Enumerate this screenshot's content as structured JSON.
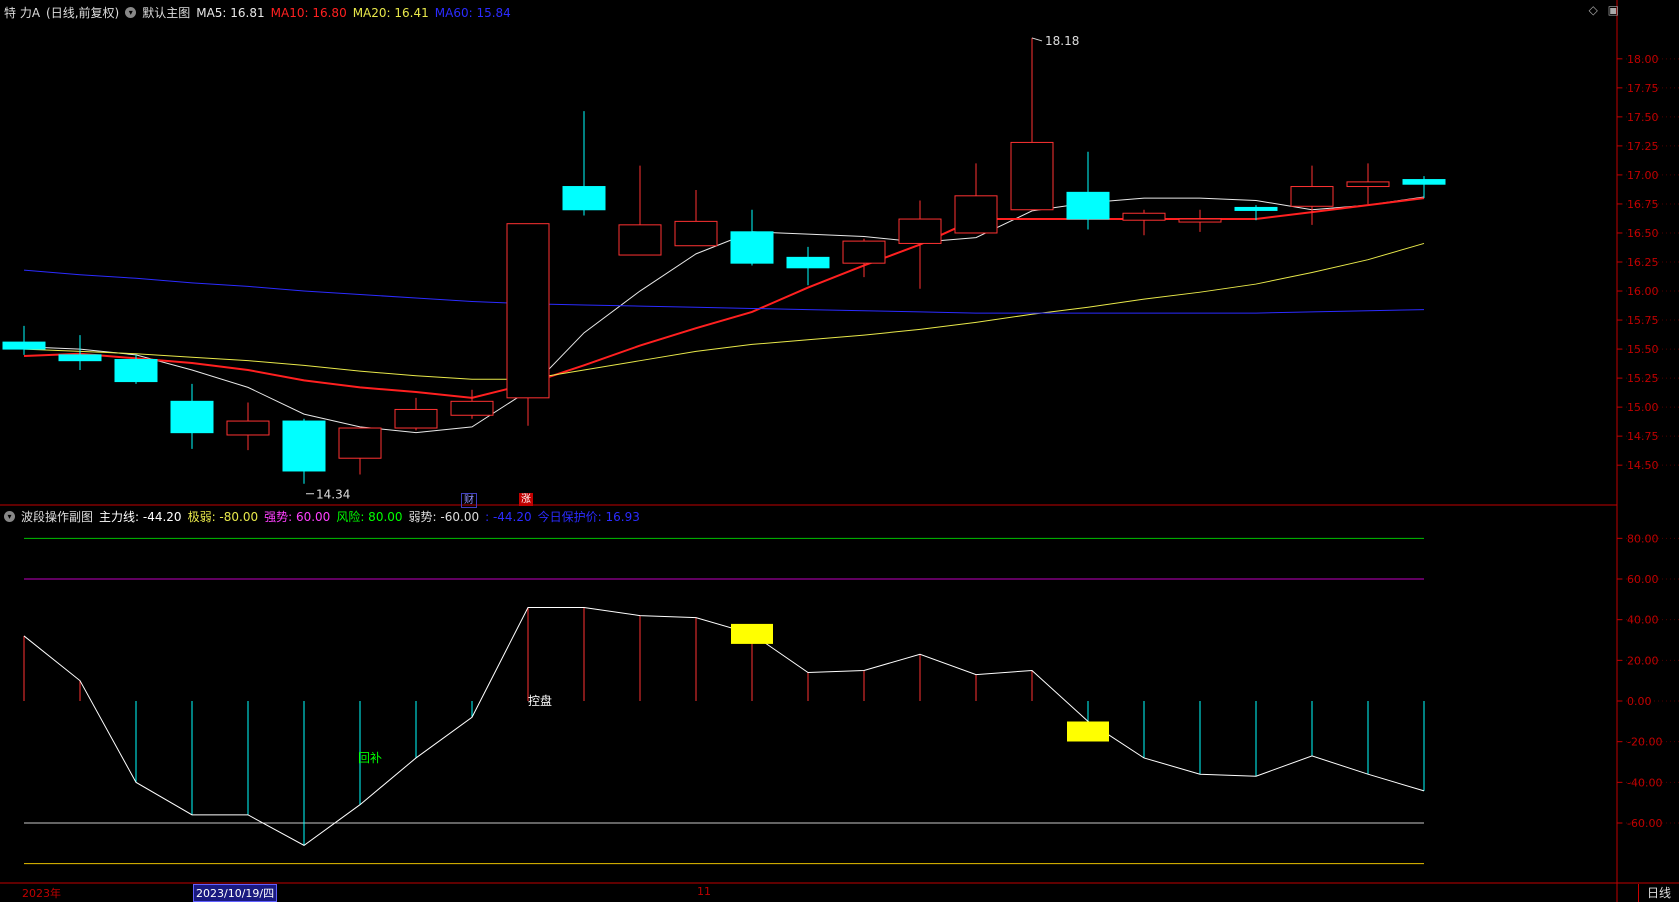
{
  "main_header": {
    "stock_name": "特 力A",
    "period_label": "(日线,前复权)",
    "template_label": "默认主图",
    "ma5": "MA5: 16.81",
    "ma10": "MA10: 16.80",
    "ma20": "MA20: 16.41",
    "ma60": "MA60: 15.84"
  },
  "sub_header": {
    "indicator_name": "波段操作副图",
    "main_line": "主力线: -44.20",
    "weak_extreme": "极弱: -80.00",
    "strong": "强势: 60.00",
    "risk": "风险: 80.00",
    "weak": "弱势: -60.00",
    "extra": ": -44.20",
    "cost_price": "今日保护价: 16.93"
  },
  "colors": {
    "up": "#ff3232",
    "down": "#00ffff",
    "ma5": "#e8e8e8",
    "ma10": "#ff2020",
    "ma20": "#e8e84a",
    "ma60": "#2b2bff",
    "axis": "#c00000"
  },
  "annotations": {
    "high_label": "18.18",
    "low_label": "14.34",
    "marker_cai": "财",
    "marker_zhang": "涨",
    "label_kongpan": "控盘",
    "label_huibu": "回补"
  },
  "bottom_bar": {
    "year_label": "2023年",
    "date_label": "2023/10/19/四",
    "month_label": "11",
    "period_button": "日线"
  },
  "chart_data": [
    {
      "type": "candlestick",
      "ylim": [
        14.2,
        18.3
      ],
      "y_ticks": [
        "18.00",
        "17.75",
        "17.50",
        "17.25",
        "17.00",
        "16.75",
        "16.50",
        "16.25",
        "16.00",
        "15.75",
        "15.50",
        "15.25",
        "15.00",
        "14.75",
        "14.50"
      ],
      "candles": [
        {
          "o": 15.56,
          "c": 15.5,
          "h": 15.7,
          "l": 15.45
        },
        {
          "o": 15.45,
          "c": 15.4,
          "h": 15.62,
          "l": 15.32
        },
        {
          "o": 15.41,
          "c": 15.22,
          "h": 15.45,
          "l": 15.2
        },
        {
          "o": 15.05,
          "c": 14.78,
          "h": 15.2,
          "l": 14.64
        },
        {
          "o": 14.76,
          "c": 14.88,
          "h": 15.04,
          "l": 14.63
        },
        {
          "o": 14.88,
          "c": 14.45,
          "h": 14.9,
          "l": 14.34
        },
        {
          "o": 14.56,
          "c": 14.82,
          "h": 14.82,
          "l": 14.42
        },
        {
          "o": 14.82,
          "c": 14.98,
          "h": 15.08,
          "l": 14.8
        },
        {
          "o": 14.93,
          "c": 15.05,
          "h": 15.15,
          "l": 14.9
        },
        {
          "o": 15.08,
          "c": 16.58,
          "h": 16.58,
          "l": 14.84
        },
        {
          "o": 16.9,
          "c": 16.7,
          "h": 17.55,
          "l": 16.65
        },
        {
          "o": 16.31,
          "c": 16.57,
          "h": 17.08,
          "l": 16.31
        },
        {
          "o": 16.39,
          "c": 16.6,
          "h": 16.87,
          "l": 16.39
        },
        {
          "o": 16.51,
          "c": 16.24,
          "h": 16.7,
          "l": 16.22
        },
        {
          "o": 16.29,
          "c": 16.2,
          "h": 16.38,
          "l": 16.05
        },
        {
          "o": 16.24,
          "c": 16.43,
          "h": 16.45,
          "l": 16.12
        },
        {
          "o": 16.41,
          "c": 16.62,
          "h": 16.78,
          "l": 16.02
        },
        {
          "o": 16.5,
          "c": 16.82,
          "h": 17.1,
          "l": 16.5
        },
        {
          "o": 16.7,
          "c": 17.28,
          "h": 18.18,
          "l": 16.7
        },
        {
          "o": 16.85,
          "c": 16.62,
          "h": 17.2,
          "l": 16.53
        },
        {
          "o": 16.61,
          "c": 16.67,
          "h": 16.7,
          "l": 16.48
        },
        {
          "o": 16.6,
          "c": 16.62,
          "h": 16.7,
          "l": 16.51
        },
        {
          "o": 16.72,
          "c": 16.71,
          "h": 16.74,
          "l": 16.61
        },
        {
          "o": 16.73,
          "c": 16.9,
          "h": 17.08,
          "l": 16.57
        },
        {
          "o": 16.9,
          "c": 16.94,
          "h": 17.1,
          "l": 16.75
        },
        {
          "o": 16.96,
          "c": 16.92,
          "h": 16.99,
          "l": 16.8
        }
      ],
      "series": [
        {
          "name": "MA5",
          "values": [
            15.52,
            15.5,
            15.45,
            15.32,
            15.17,
            14.94,
            14.83,
            14.78,
            14.83,
            15.14,
            15.64,
            16.0,
            16.32,
            16.51,
            16.49,
            16.47,
            16.42,
            16.46,
            16.69,
            16.76,
            16.8,
            16.8,
            16.78,
            16.7,
            16.74,
            16.81
          ]
        },
        {
          "name": "MA10",
          "values": [
            15.44,
            15.46,
            15.42,
            15.38,
            15.32,
            15.23,
            15.17,
            15.13,
            15.08,
            15.2,
            15.36,
            15.53,
            15.68,
            15.82,
            16.03,
            16.22,
            16.4,
            16.62,
            16.62,
            16.62,
            16.62,
            16.62,
            16.62,
            16.68,
            16.74,
            16.8
          ]
        },
        {
          "name": "MA20",
          "values": [
            15.5,
            15.48,
            15.46,
            15.43,
            15.4,
            15.36,
            15.31,
            15.27,
            15.24,
            15.24,
            15.32,
            15.4,
            15.48,
            15.54,
            15.58,
            15.62,
            15.67,
            15.73,
            15.8,
            15.86,
            15.93,
            15.99,
            16.06,
            16.16,
            16.27,
            16.41
          ]
        },
        {
          "name": "MA60",
          "values": [
            16.18,
            16.14,
            16.11,
            16.07,
            16.04,
            16.0,
            15.97,
            15.94,
            15.91,
            15.89,
            15.88,
            15.87,
            15.86,
            15.85,
            15.84,
            15.83,
            15.82,
            15.81,
            15.81,
            15.81,
            15.81,
            15.81,
            15.81,
            15.82,
            15.83,
            15.84
          ]
        }
      ]
    },
    {
      "type": "line",
      "ylim": [
        -90,
        90
      ],
      "y_ticks": [
        "80.00",
        "60.00",
        "40.00",
        "20.00",
        "0.00",
        "-20.00",
        "-40.00",
        "-60.00"
      ],
      "levels": [
        80,
        60,
        -60,
        -80
      ],
      "series": [
        {
          "name": "主力线",
          "values": [
            32,
            10,
            -40,
            -56,
            -56,
            -71,
            -51,
            -28,
            -8,
            46,
            46,
            42,
            41,
            33,
            14,
            15,
            23,
            13,
            15,
            -10,
            -28,
            -36,
            -37,
            -27,
            -36,
            -44.2
          ]
        }
      ],
      "highlight_boxes": [
        {
          "index": 13,
          "value": 33
        },
        {
          "index": 19,
          "value": -15
        }
      ]
    }
  ]
}
